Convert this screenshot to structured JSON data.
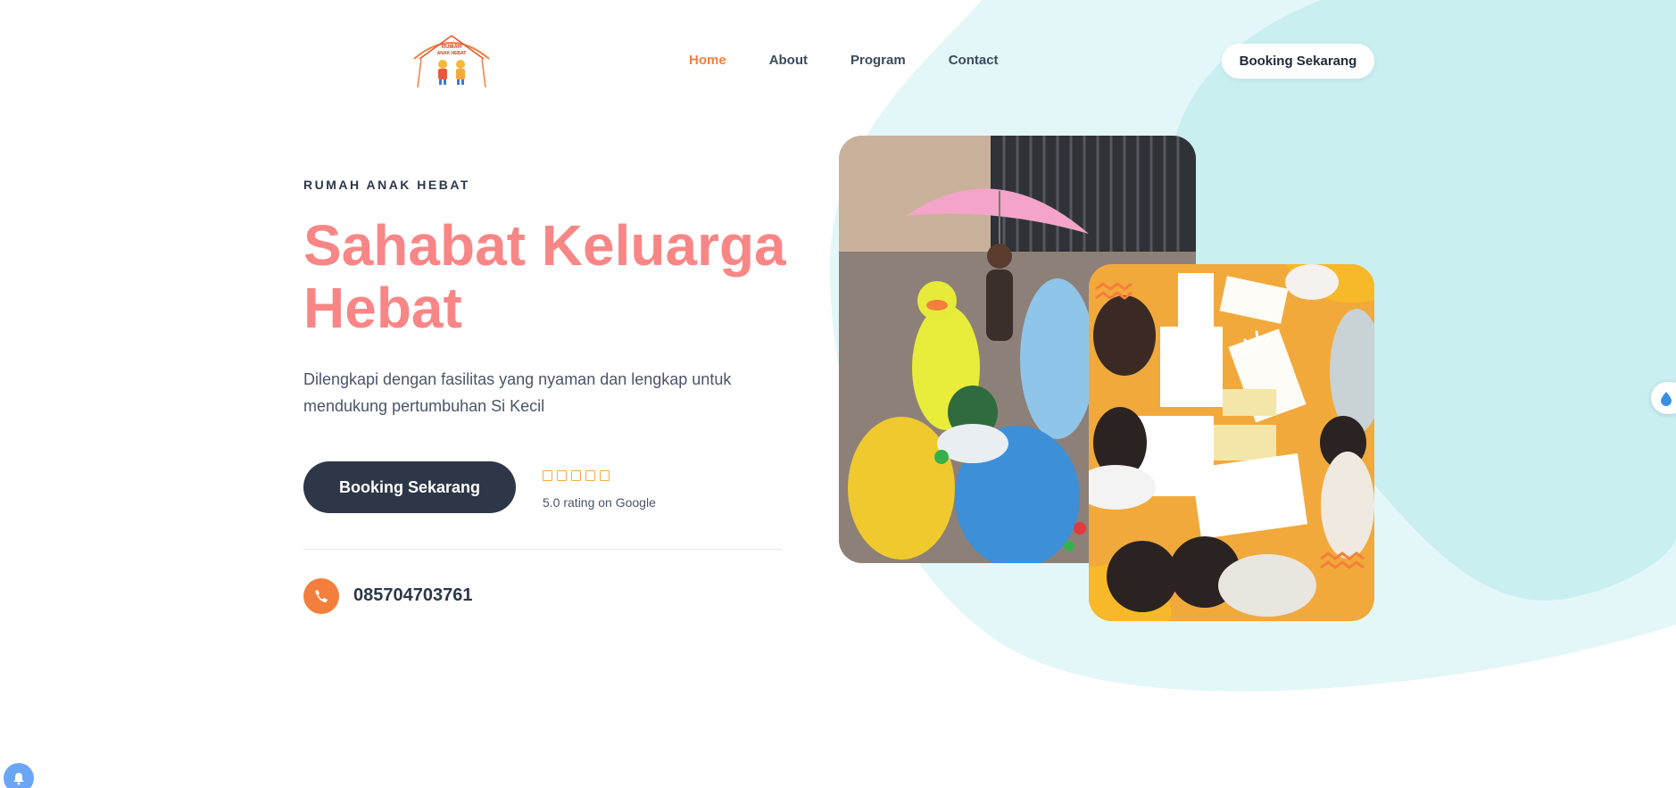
{
  "header": {
    "logo_text_top": "RUMAH",
    "logo_text_bottom": "ANAK HEBAT",
    "nav": [
      {
        "label": "Home",
        "active": true
      },
      {
        "label": "About",
        "active": false
      },
      {
        "label": "Program",
        "active": false
      },
      {
        "label": "Contact",
        "active": false
      }
    ],
    "booking_label": "Booking Sekarang"
  },
  "hero": {
    "eyebrow": "RUMAH ANAK HEBAT",
    "title_line1": "Sahabat Keluarga",
    "title_line2": "Hebat",
    "description_line1": "Dilengkapi dengan fasilitas yang nyaman dan lengkap untuk",
    "description_line2": "mendukung pertumbuhan Si Kecil",
    "cta_label": "Booking Sekarang",
    "rating_stars": 5,
    "rating_text": "5.0 rating on Google",
    "phone": "085704703761"
  },
  "colors": {
    "accent_orange": "#f47f3c",
    "title_pink": "#f98686",
    "dark_navy": "#2d3748",
    "blob_light": "#e3f7f8",
    "blob_mid": "#c9eff0"
  },
  "icons": {
    "phone": "phone-icon",
    "notification": "bell-icon",
    "side_widget": "drop-icon"
  }
}
